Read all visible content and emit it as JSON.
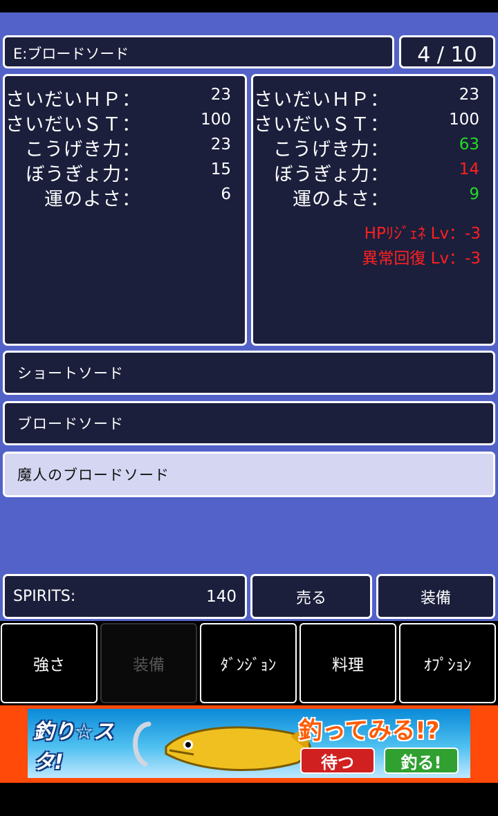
{
  "equipped": "E:ブロードソード",
  "counter": "4 / 10",
  "stat_labels": [
    "さいだいＨＰ：",
    "さいだいＳＴ：",
    "こうげき力：",
    "ぼうぎょ力：",
    "運のよさ："
  ],
  "current_stats": [
    "23",
    "100",
    "23",
    "15",
    "6"
  ],
  "preview_stats": [
    "23",
    "100",
    "63",
    "14",
    "9"
  ],
  "preview_colors": [
    "#ffffff",
    "#ffffff",
    "#22dd22",
    "#ff2020",
    "#22dd22"
  ],
  "preview_extras": [
    "HPﾘｼﾞｪﾈ Lv：-3",
    "異常回復 Lv：-3"
  ],
  "weapons": [
    "ショートソード",
    "ブロードソード",
    "魔人のブロードソード"
  ],
  "selected_index": 2,
  "spirits_label": "SPIRITS:",
  "spirits_value": "140",
  "sell_button": "売る",
  "equip_button": "装備",
  "nav": [
    "強さ",
    "装備",
    "ﾀﾞﾝｼﾞｮﾝ",
    "料理",
    "ｵﾌﾟｼｮﾝ"
  ],
  "nav_disabled_index": 1,
  "ad": {
    "logo": "釣り☆スタ!",
    "headline": "釣ってみる!?",
    "btn_wait": "待つ",
    "btn_fish": "釣る!"
  }
}
